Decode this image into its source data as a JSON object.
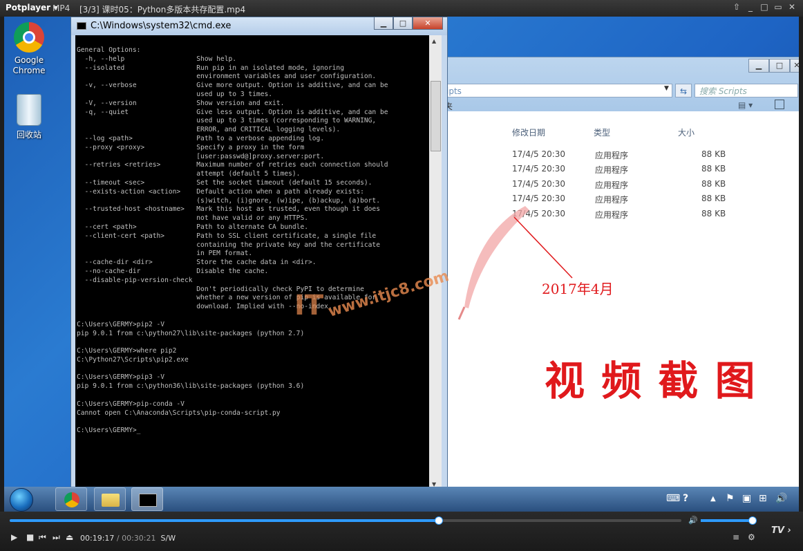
{
  "player": {
    "brand": "Potplayer",
    "format": "MP4",
    "title": "[3/3] 课时05：Python多版本共存配置.mp4",
    "controls": {
      "pin": "⇧",
      "minimize": "_",
      "restore": "□",
      "maximize": "▭",
      "close": "✕"
    }
  },
  "desktop": {
    "icons": [
      {
        "label": "Google\nChrome"
      },
      {
        "label": "回收站"
      }
    ]
  },
  "explorer": {
    "address_fragment": "ipts",
    "search_placeholder": "搜索 Scripts",
    "toolbar_fragment": "夹",
    "columns": [
      "修改日期",
      "类型",
      "大小"
    ],
    "rows": [
      {
        "date": "17/4/5 20:30",
        "type": "应用程序",
        "size": "88 KB"
      },
      {
        "date": "17/4/5 20:30",
        "type": "应用程序",
        "size": "88 KB"
      },
      {
        "date": "17/4/5 20:30",
        "type": "应用程序",
        "size": "88 KB"
      },
      {
        "date": "17/4/5 20:30",
        "type": "应用程序",
        "size": "88 KB"
      },
      {
        "date": "17/4/5 20:30",
        "type": "应用程序",
        "size": "88 KB"
      }
    ]
  },
  "cmd": {
    "title": "C:\\Windows\\system32\\cmd.exe",
    "text": "General Options:\n  -h, --help                  Show help.\n  --isolated                  Run pip in an isolated mode, ignoring\n                              environment variables and user configuration.\n  -v, --verbose               Give more output. Option is additive, and can be\n                              used up to 3 times.\n  -V, --version               Show version and exit.\n  -q, --quiet                 Give less output. Option is additive, and can be\n                              used up to 3 times (corresponding to WARNING,\n                              ERROR, and CRITICAL logging levels).\n  --log <path>                Path to a verbose appending log.\n  --proxy <proxy>             Specify a proxy in the form\n                              [user:passwd@]proxy.server:port.\n  --retries <retries>         Maximum number of retries each connection should\n                              attempt (default 5 times).\n  --timeout <sec>             Set the socket timeout (default 15 seconds).\n  --exists-action <action>    Default action when a path already exists:\n                              (s)witch, (i)gnore, (w)ipe, (b)ackup, (a)bort.\n  --trusted-host <hostname>   Mark this host as trusted, even though it does\n                              not have valid or any HTTPS.\n  --cert <path>               Path to alternate CA bundle.\n  --client-cert <path>        Path to SSL client certificate, a single file\n                              containing the private key and the certificate\n                              in PEM format.\n  --cache-dir <dir>           Store the cache data in <dir>.\n  --no-cache-dir              Disable the cache.\n  --disable-pip-version-check\n                              Don't periodically check PyPI to determine\n                              whether a new version of pip is available for\n                              download. Implied with --no-index.\n\nC:\\Users\\GERMY>pip2 -V\npip 9.0.1 from c:\\python27\\lib\\site-packages (python 2.7)\n\nC:\\Users\\GERMY>where pip2\nC:\\Python27\\Scripts\\pip2.exe\n\nC:\\Users\\GERMY>pip3 -V\npip 9.0.1 from c:\\python36\\lib\\site-packages (python 3.6)\n\nC:\\Users\\GERMY>pip-conda -V\nCannot open C:\\Anaconda\\Scripts\\pip-conda-script.py\n\nC:\\Users\\GERMY>_"
  },
  "annotations": {
    "date_label": "2017年4月",
    "big_label": "视 频 截 图",
    "watermark_url": "www.itjc8.com",
    "watermark_it": "IT"
  },
  "playback": {
    "current": "00:19:17",
    "total": "/ 00:30:21",
    "mode": "S/W",
    "progress": 0.638,
    "volume": 1.0,
    "tv_label": "TV",
    "btn_play": "▶",
    "btn_stop": "■",
    "btn_prev": "⏮",
    "btn_next": "⏭",
    "btn_eject": "⏏",
    "btn_vol": "🔊",
    "btn_menu": "≡",
    "btn_settings": "⚙",
    "btn_tv_arrow": "›"
  },
  "tray": {
    "help": "?",
    "up_arrow": "▲",
    "speaker": "🔊"
  },
  "theme": {
    "accent": "#2f9bff",
    "annot_red": "#e0191c"
  }
}
